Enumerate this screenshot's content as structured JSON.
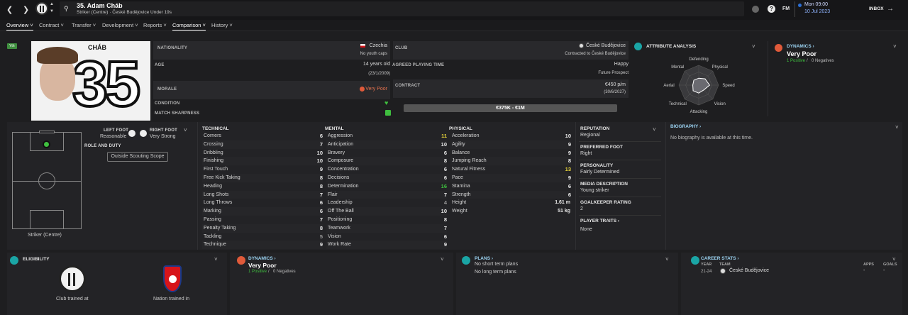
{
  "header": {
    "player_title": "35. Adam Cháb",
    "player_subtitle": "Striker (Centre) · České Budějovice Under 19s",
    "date_line1": "Mon 09:00",
    "date_line2": "10 Jul 2023",
    "inbox_label": "INBOX",
    "fm_label": "FM"
  },
  "tabs": [
    {
      "label": "Overview"
    },
    {
      "label": "Contract"
    },
    {
      "label": "Transfer"
    },
    {
      "label": "Development"
    },
    {
      "label": "Reports"
    },
    {
      "label": "Comparison"
    },
    {
      "label": "History"
    }
  ],
  "profile": {
    "badge": "Yth",
    "shirt_name": "CHÁB",
    "shirt_number": "35",
    "nationality_label": "NATIONALITY",
    "nationality": "Czechia",
    "youth_caps": "No youth caps",
    "age_label": "AGE",
    "age": "14 years old",
    "dob": "(23/1/2009)",
    "morale_label": "MORALE",
    "morale": "Very Poor",
    "condition_label": "CONDITION",
    "sharpness_label": "MATCH SHARPNESS",
    "club_label": "CLUB",
    "club": "České Budějovice",
    "contracted": "Contracted to České Budějovice",
    "playing_time_label": "AGREED PLAYING TIME",
    "happy": "Happy",
    "future": "Future Prospect",
    "contract_label": "CONTRACT",
    "wage": "€450 p/m",
    "contract_end": "(30/6/2027)",
    "value": "€375K - €1M"
  },
  "attribute_analysis": {
    "title": "ATTRIBUTE ANALYSIS",
    "axes": [
      "Defending",
      "Physical",
      "Speed",
      "Vision",
      "Attacking",
      "Technical",
      "Aerial",
      "Mental"
    ],
    "levels": [
      0.35,
      0.45,
      0.55,
      0.35,
      0.4,
      0.4,
      0.3,
      0.35
    ]
  },
  "dynamics_top": {
    "title": "DYNAMICS",
    "value": "Very Poor",
    "positives": "1 Positive",
    "slash": "/",
    "negatives": "0 Negatives"
  },
  "pitch": {
    "position_label": "Striker (Centre)",
    "left_foot_label": "LEFT FOOT",
    "left_foot": "Reasonable",
    "right_foot_label": "RIGHT FOOT",
    "right_foot": "Very Strong",
    "role_label": "ROLE AND DUTY",
    "scouting_button": "Outside Scouting Scope"
  },
  "technical": {
    "title": "TECHNICAL",
    "items": [
      {
        "name": "Corners",
        "value": "6"
      },
      {
        "name": "Crossing",
        "value": "7"
      },
      {
        "name": "Dribbling",
        "value": "10"
      },
      {
        "name": "Finishing",
        "value": "10"
      },
      {
        "name": "First Touch",
        "value": "9"
      },
      {
        "name": "Free Kick Taking",
        "value": "8"
      },
      {
        "name": "Heading",
        "value": "8"
      },
      {
        "name": "Long Shots",
        "value": "7"
      },
      {
        "name": "Long Throws",
        "value": "6"
      },
      {
        "name": "Marking",
        "value": "6"
      },
      {
        "name": "Passing",
        "value": "7"
      },
      {
        "name": "Penalty Taking",
        "value": "8"
      },
      {
        "name": "Tackling",
        "value": "5"
      },
      {
        "name": "Technique",
        "value": "9"
      }
    ]
  },
  "mental": {
    "title": "MENTAL",
    "items": [
      {
        "name": "Aggression",
        "value": "11"
      },
      {
        "name": "Anticipation",
        "value": "10"
      },
      {
        "name": "Bravery",
        "value": "6"
      },
      {
        "name": "Composure",
        "value": "8"
      },
      {
        "name": "Concentration",
        "value": "6"
      },
      {
        "name": "Decisions",
        "value": "6"
      },
      {
        "name": "Determination",
        "value": "16"
      },
      {
        "name": "Flair",
        "value": "7"
      },
      {
        "name": "Leadership",
        "value": "4"
      },
      {
        "name": "Off The Ball",
        "value": "10"
      },
      {
        "name": "Positioning",
        "value": "8"
      },
      {
        "name": "Teamwork",
        "value": "7"
      },
      {
        "name": "Vision",
        "value": "6"
      },
      {
        "name": "Work Rate",
        "value": "9"
      }
    ]
  },
  "physical": {
    "title": "PHYSICAL",
    "items": [
      {
        "name": "Acceleration",
        "value": "10"
      },
      {
        "name": "Agility",
        "value": "9"
      },
      {
        "name": "Balance",
        "value": "9"
      },
      {
        "name": "Jumping Reach",
        "value": "8"
      },
      {
        "name": "Natural Fitness",
        "value": "13"
      },
      {
        "name": "Pace",
        "value": "9"
      },
      {
        "name": "Stamina",
        "value": "6"
      },
      {
        "name": "Strength",
        "value": "6"
      }
    ],
    "height_label": "Height",
    "height": "1.61 m",
    "weight_label": "Weight",
    "weight": "51 kg"
  },
  "info": {
    "reputation_label": "REPUTATION",
    "reputation": "Regional",
    "foot_label": "PREFERRED FOOT",
    "foot": "Right",
    "personality_label": "PERSONALITY",
    "personality": "Fairly Determined",
    "media_label": "MEDIA DESCRIPTION",
    "media": "Young striker",
    "gk_label": "GOALKEEPER RATING",
    "gk": "2",
    "traits_label": "PLAYER TRAITS",
    "traits": "None"
  },
  "biography": {
    "title": "BIOGRAPHY",
    "text": "No biography is available at this time."
  },
  "eligibility": {
    "title": "ELIGIBILITY",
    "club_trained": "Club trained at",
    "nation_trained": "Nation trained in"
  },
  "dynamics_bottom": {
    "title": "DYNAMICS",
    "value": "Very Poor",
    "positives": "1 Positive",
    "slash": "/",
    "negatives": "0 Negatives"
  },
  "plans": {
    "title": "PLANS",
    "short": "No short term plans",
    "long": "No long term plans"
  },
  "career": {
    "title": "CAREER STATS",
    "col_year": "YEAR",
    "col_team": "TEAM",
    "col_apps": "APPS",
    "col_goals": "GOALS",
    "year": "21-24",
    "team": "České Budějovice",
    "apps": "-",
    "goals": "-"
  },
  "colors": {
    "accent_teal": "#1aa5a5",
    "positive_green": "#3fbf3f",
    "negative_red": "#e05a3a",
    "highlight_yellow": "#e6d33a"
  }
}
